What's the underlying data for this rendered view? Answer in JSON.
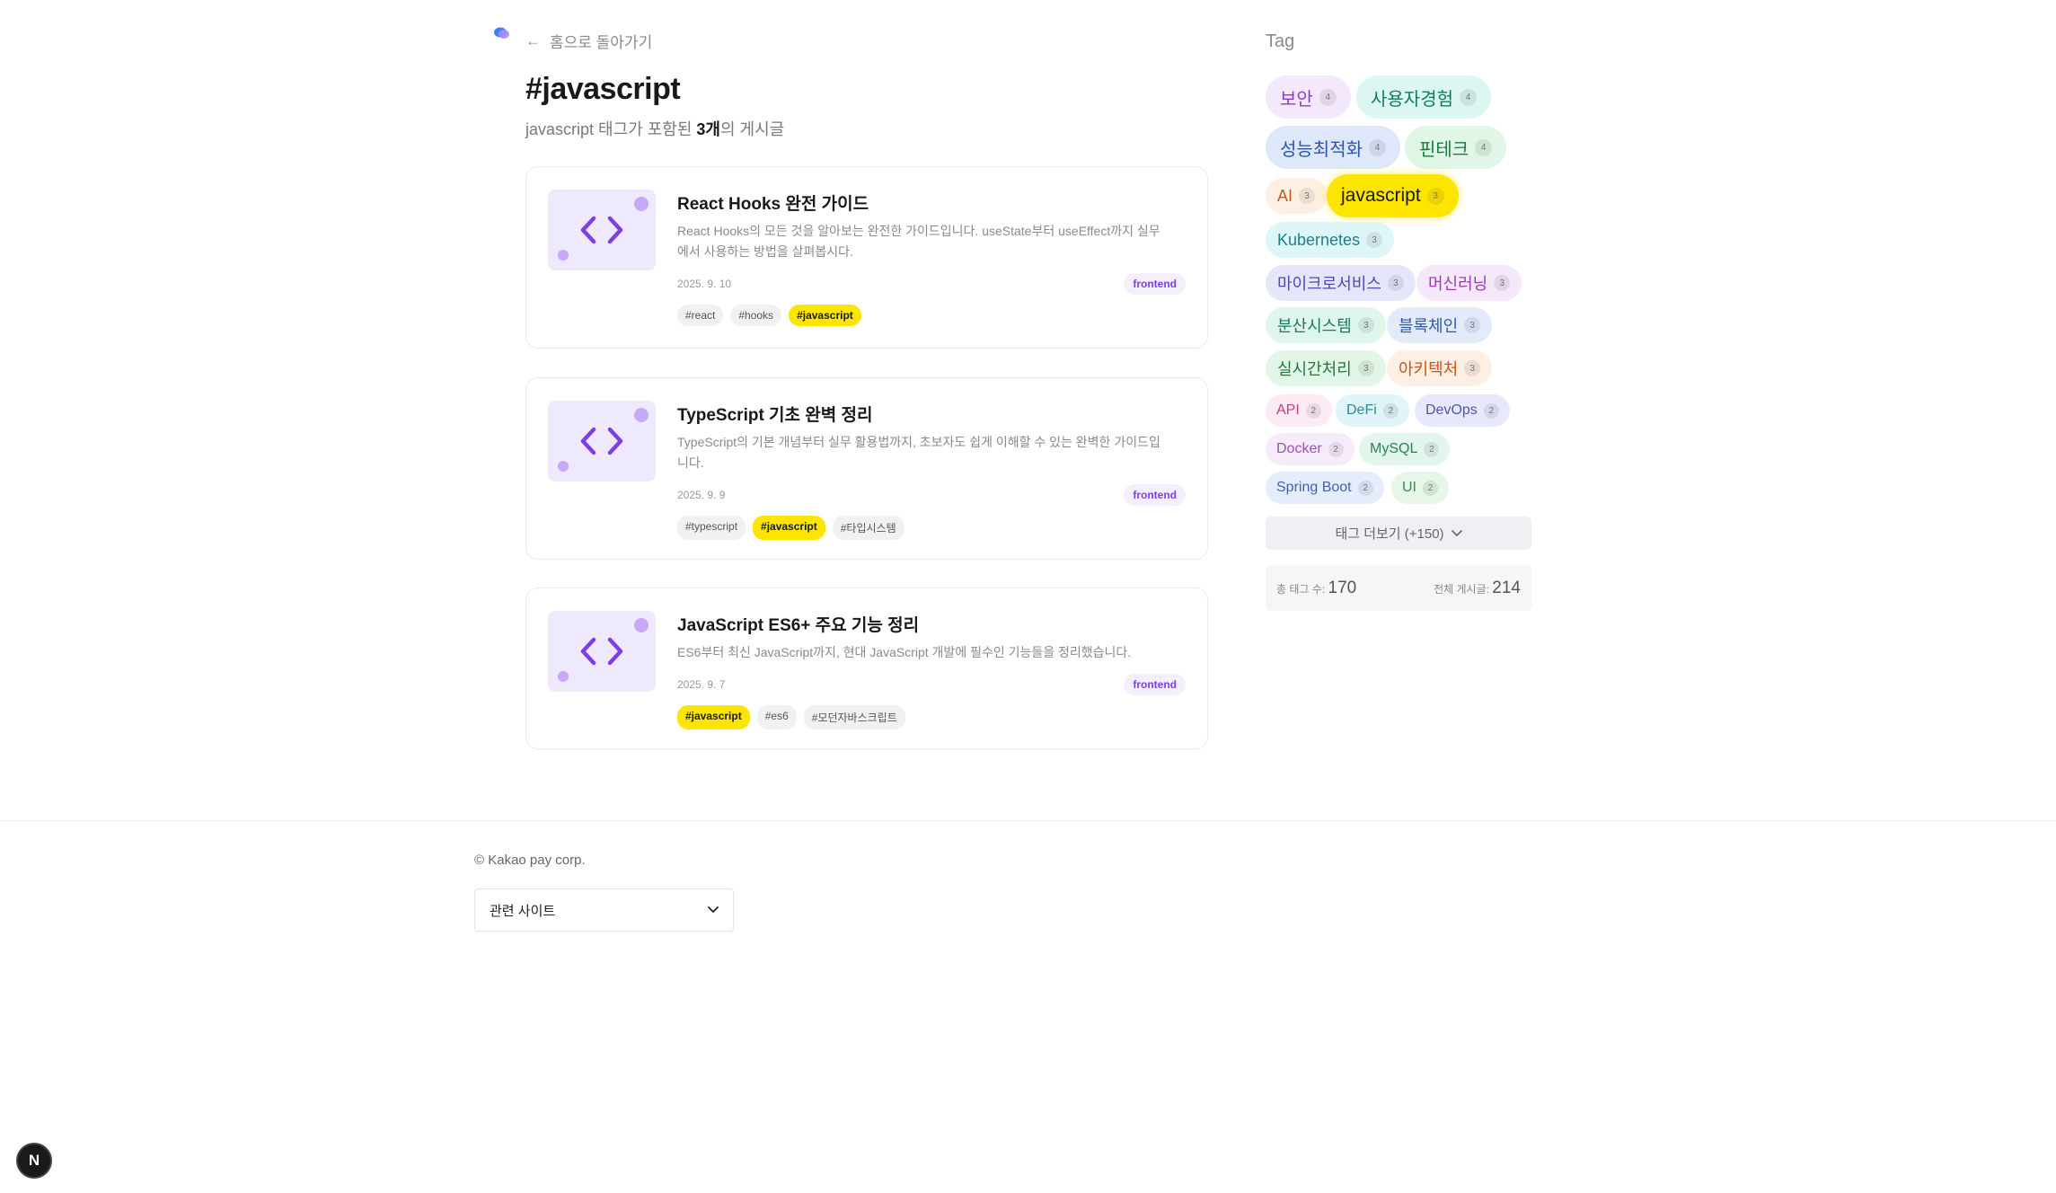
{
  "nav": {
    "back_label": "홈으로 돌아가기",
    "back_arrow": "←"
  },
  "header": {
    "title": "#javascript",
    "subtitle_prefix": "javascript 태그가 포함된 ",
    "subtitle_count": "3개",
    "subtitle_suffix": "의 게시글"
  },
  "posts": [
    {
      "title": "React Hooks 완전 가이드",
      "desc": "React Hooks의 모든 것을 알아보는 완전한 가이드입니다. useState부터 useEffect까지 실무에서 사용하는 방법을 살펴봅시다.",
      "date": "2025. 9. 10",
      "category": "frontend",
      "tags": [
        "#react",
        "#hooks",
        "#javascript"
      ]
    },
    {
      "title": "TypeScript 기초 완벽 정리",
      "desc": "TypeScript의 기본 개념부터 실무 활용법까지, 초보자도 쉽게 이해할 수 있는 완벽한 가이드입니다.",
      "date": "2025. 9. 9",
      "category": "frontend",
      "tags": [
        "#typescript",
        "#javascript",
        "#타입시스템"
      ]
    },
    {
      "title": "JavaScript ES6+ 주요 기능 정리",
      "desc": "ES6부터 최신 JavaScript까지, 현대 JavaScript 개발에 필수인 기능들을 정리했습니다.",
      "date": "2025. 9. 7",
      "category": "frontend",
      "tags": [
        "#javascript",
        "#es6",
        "#모던자바스크립트"
      ]
    }
  ],
  "sidebar": {
    "title": "Tag",
    "tags": [
      {
        "name": "보안",
        "count": "4",
        "bg": "#f4e8fc",
        "fg": "#8e3ac9"
      },
      {
        "name": "사용자경험",
        "count": "4",
        "bg": "#dcf7f1",
        "fg": "#0f7a64"
      },
      {
        "name": "성능최적화",
        "count": "4",
        "bg": "#dfe8fb",
        "fg": "#2a55b0"
      },
      {
        "name": "핀테크",
        "count": "4",
        "bg": "#e0f6e6",
        "fg": "#1c7a3e"
      },
      {
        "name": "AI",
        "count": "3",
        "bg": "#fdf0e3",
        "fg": "#c25a1f"
      },
      {
        "name": "javascript",
        "count": "3",
        "bg": "#fee500",
        "fg": "#191919"
      },
      {
        "name": "Kubernetes",
        "count": "3",
        "bg": "#dff6f8",
        "fg": "#1c7f8a"
      },
      {
        "name": "마이크로서비스",
        "count": "3",
        "bg": "#e6e6fb",
        "fg": "#4d4ab0"
      },
      {
        "name": "머신러닝",
        "count": "3",
        "bg": "#f6e8fb",
        "fg": "#9a3ab5"
      },
      {
        "name": "분산시스템",
        "count": "3",
        "bg": "#dff6ec",
        "fg": "#1a7a55"
      },
      {
        "name": "블록체인",
        "count": "3",
        "bg": "#e3ebfb",
        "fg": "#3358a8"
      },
      {
        "name": "실시간처리",
        "count": "3",
        "bg": "#e2f6e7",
        "fg": "#24783e"
      },
      {
        "name": "아키텍처",
        "count": "3",
        "bg": "#fdefe3",
        "fg": "#c2561d"
      },
      {
        "name": "API",
        "count": "2",
        "bg": "#fcebf4",
        "fg": "#c23d84"
      },
      {
        "name": "DeFi",
        "count": "2",
        "bg": "#dff5f8",
        "fg": "#2c8b96"
      },
      {
        "name": "DevOps",
        "count": "2",
        "bg": "#e7e9fb",
        "fg": "#5053b3"
      },
      {
        "name": "Docker",
        "count": "2",
        "bg": "#f6ebfb",
        "fg": "#9a4fbd"
      },
      {
        "name": "MySQL",
        "count": "2",
        "bg": "#e2f6ed",
        "fg": "#2a8059"
      },
      {
        "name": "Spring Boot",
        "count": "2",
        "bg": "#e5ecfb",
        "fg": "#4162ad"
      },
      {
        "name": "UI",
        "count": "2",
        "bg": "#e6f6e8",
        "fg": "#3a8a4b"
      }
    ],
    "more_label": "태그 더보기 (+150)",
    "stats": {
      "total_tags_label": "총 태그 수:",
      "total_tags": "170",
      "total_posts_label": "전체 게시글:",
      "total_posts": "214"
    }
  },
  "footer": {
    "copyright": "© Kakao pay corp.",
    "related_select": "관련 사이트"
  },
  "dev_badge": "N"
}
